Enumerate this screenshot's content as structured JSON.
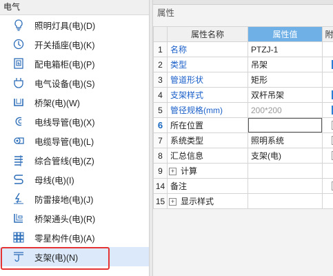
{
  "left_panel": {
    "title": "电气",
    "items": [
      {
        "label": "照明灯具(电)(D)",
        "icon": "lightbulb-icon"
      },
      {
        "label": "开关插座(电)(K)",
        "icon": "switch-socket-icon"
      },
      {
        "label": "配电箱柜(电)(P)",
        "icon": "distribution-box-icon"
      },
      {
        "label": "电气设备(电)(S)",
        "icon": "electrical-equipment-icon"
      },
      {
        "label": "桥架(电)(W)",
        "icon": "cable-tray-icon"
      },
      {
        "label": "电线导管(电)(X)",
        "icon": "wire-conduit-icon"
      },
      {
        "label": "电缆导管(电)(L)",
        "icon": "cable-conduit-icon"
      },
      {
        "label": "综合管线(电)(Z)",
        "icon": "combined-pipeline-icon"
      },
      {
        "label": "母线(电)(I)",
        "icon": "busbar-icon"
      },
      {
        "label": "防雷接地(电)(J)",
        "icon": "lightning-ground-icon"
      },
      {
        "label": "桥架通头(电)(R)",
        "icon": "tray-fitting-icon"
      },
      {
        "label": "零星构件(电)(A)",
        "icon": "misc-component-icon"
      },
      {
        "label": "支架(电)(N)",
        "icon": "support-bracket-icon"
      }
    ],
    "selected_index": 12
  },
  "right_panel": {
    "title": "属性",
    "header": {
      "name_col": "属性名称",
      "value_col": "属性值",
      "extra_col": "附"
    },
    "rows": [
      {
        "num": "1",
        "name": "名称",
        "value": "PTZJ-1"
      },
      {
        "num": "2",
        "name": "类型",
        "value": "吊架"
      },
      {
        "num": "3",
        "name": "管道形状",
        "value": "矩形"
      },
      {
        "num": "4",
        "name": "支架样式",
        "value": "双杆吊架"
      },
      {
        "num": "5",
        "name": "管径规格(mm)",
        "value": "200*200"
      },
      {
        "num": "6",
        "name": "所在位置",
        "value": ""
      },
      {
        "num": "7",
        "name": "系统类型",
        "value": "照明系统"
      },
      {
        "num": "8",
        "name": "汇总信息",
        "value": "支架(电)"
      },
      {
        "num": "9",
        "name": "计算",
        "value": ""
      },
      {
        "num": "14",
        "name": "备注",
        "value": ""
      },
      {
        "num": "15",
        "name": "显示样式",
        "value": ""
      }
    ]
  },
  "colors": {
    "selection_bg": "#dbe9fb",
    "highlight_border": "#e53333",
    "value_header_bg": "#6fb0e6",
    "blue_text": "#1a5fc9"
  }
}
